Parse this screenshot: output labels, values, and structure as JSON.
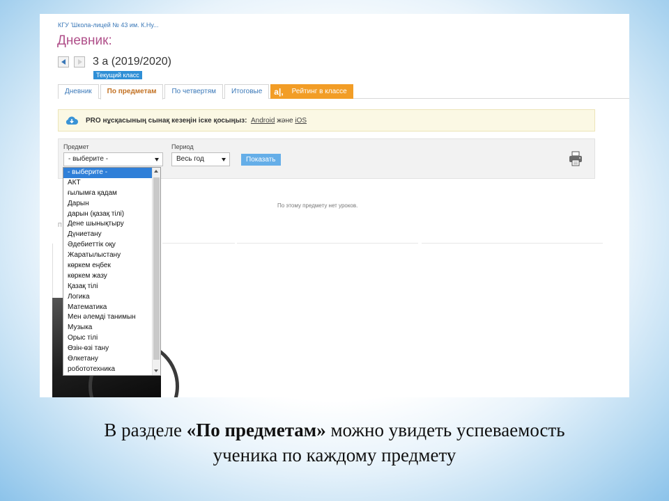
{
  "header": {
    "school": "КГУ 'Школа-лицей № 43 им. К.Ну...",
    "title": "Дневник:",
    "class_name": "3 а (2019/2020)",
    "class_badge": "Текущий класс"
  },
  "tabs": [
    {
      "label": "Дневник",
      "active": false
    },
    {
      "label": "По предметам",
      "active": true
    },
    {
      "label": "По четвертям",
      "active": false
    },
    {
      "label": "Итоговые",
      "active": false
    },
    {
      "label": "Рейтинг в классе",
      "active": false,
      "logo": "a|,"
    }
  ],
  "notice": {
    "text": "PRO нұсқасының сынақ кезеңін іске қосыңыз:",
    "link_android": "Android",
    "conjunction": "және",
    "link_ios": "iOS",
    "icon": "cloud-download-icon"
  },
  "filter": {
    "subject_label": "Предмет",
    "subject_value": "- выберите -",
    "period_label": "Период",
    "period_value": "Весь год",
    "show_button": "Показать",
    "print_icon": "printer-icon"
  },
  "dropdown": {
    "selected_index": 0,
    "items": [
      "- выберите -",
      "АКТ",
      "ғылымға қадам",
      "Дарын",
      "дарын (қазақ тілі)",
      "Дене шынықтыру",
      "Дүниетану",
      "Әдебиеттік оқу",
      "Жаратылыстану",
      "көркем еңбек",
      "көркем жазу",
      "Қазақ тілі",
      "Логика",
      "Математика",
      "Мен әлемді танимын",
      "Музыка",
      "Орыс тілі",
      "Өзін-өзі тану",
      "Өлкетану",
      "робототехника"
    ]
  },
  "content": {
    "empty_message": "По этому предмету нет уроков.",
    "faint_label": "П"
  },
  "caption": {
    "part1": "В разделе ",
    "bold": "«По предметам»",
    "part2": " можно увидеть успеваемость",
    "line2": "ученика по каждому предмету"
  },
  "colors": {
    "accent_blue": "#2f8fd6",
    "title_pink": "#b0508a",
    "rating_orange": "#f29d26",
    "active_tab_text": "#c27021"
  }
}
